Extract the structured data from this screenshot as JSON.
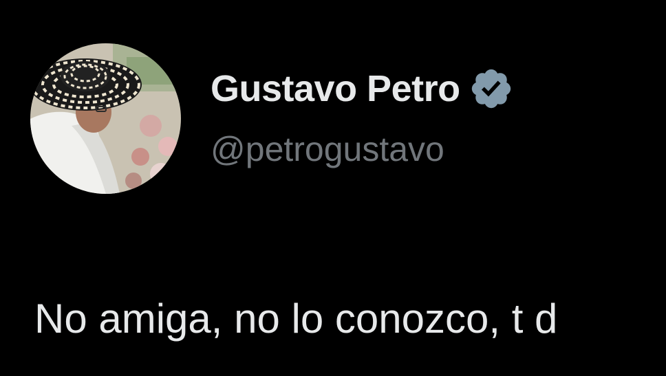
{
  "author": {
    "display_name": "Gustavo Petro",
    "handle": "@petrogustavo",
    "verified_icon": "verified-badge-icon",
    "avatar_icon": "profile-photo"
  },
  "tweet": {
    "text": "No amiga, no lo conozco, t d"
  },
  "colors": {
    "background": "#000000",
    "name": "#e7e9ea",
    "handle": "#71767b",
    "verified": "#829aab"
  }
}
